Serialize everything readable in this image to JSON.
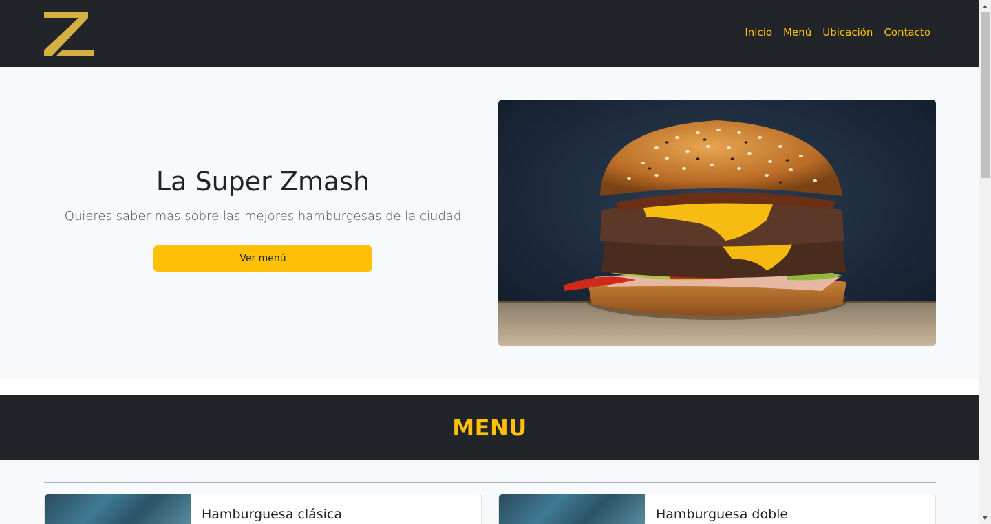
{
  "navbar": {
    "logo_icon": "z-logo-icon",
    "links": [
      "Inicio",
      "Menú",
      "Ubicación",
      "Contacto"
    ],
    "link_color": "#ffc107",
    "background": "#212529"
  },
  "hero": {
    "title": "La Super Zmash",
    "subtitle": "Quieres saber mas sobre las mejores hamburgesas de la ciudad",
    "button_label": "Ver menú",
    "image_icon": "burger-photo"
  },
  "menu": {
    "title": "MENU",
    "items": [
      {
        "title": "Hamburguesa clásica"
      },
      {
        "title": "Hamburguesa doble"
      }
    ]
  },
  "colors": {
    "accent": "#ffc107",
    "dark": "#212529",
    "light": "#f8f9fa"
  }
}
